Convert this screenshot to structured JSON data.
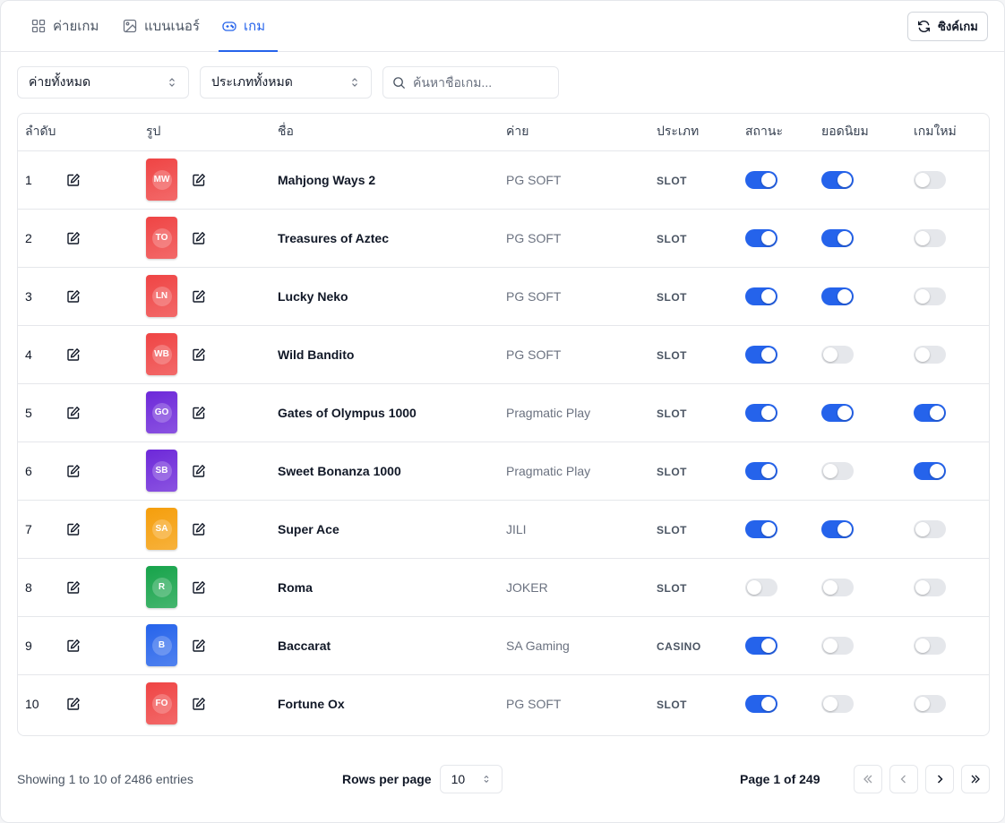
{
  "tabs": [
    {
      "label": "ค่ายเกม",
      "icon": "grid-icon",
      "active": false
    },
    {
      "label": "แบนเนอร์",
      "icon": "image-icon",
      "active": false
    },
    {
      "label": "เกม",
      "icon": "gamepad-icon",
      "active": true
    }
  ],
  "sync_button": {
    "label": "ซิงค์เกม",
    "icon": "refresh-icon"
  },
  "filters": {
    "provider_select": "ค่ายทั้งหมด",
    "type_select": "ประเภททั้งหมด",
    "search_placeholder": "ค้นหาชื่อเกม..."
  },
  "table": {
    "headers": [
      "ลำดับ",
      "รูป",
      "ชื่อ",
      "ค่าย",
      "ประเภท",
      "สถานะ",
      "ยอดนิยม",
      "เกมใหม่"
    ],
    "rows": [
      {
        "index": "1",
        "initials": "MW",
        "name": "Mahjong Ways 2",
        "provider": "PG SOFT",
        "type": "SLOT",
        "status": true,
        "popular": true,
        "new": false,
        "color": "#ef4444"
      },
      {
        "index": "2",
        "initials": "TO",
        "name": "Treasures of Aztec",
        "provider": "PG SOFT",
        "type": "SLOT",
        "status": true,
        "popular": true,
        "new": false,
        "color": "#ef4444"
      },
      {
        "index": "3",
        "initials": "LN",
        "name": "Lucky Neko",
        "provider": "PG SOFT",
        "type": "SLOT",
        "status": true,
        "popular": true,
        "new": false,
        "color": "#ef4444"
      },
      {
        "index": "4",
        "initials": "WB",
        "name": "Wild Bandito",
        "provider": "PG SOFT",
        "type": "SLOT",
        "status": true,
        "popular": false,
        "new": false,
        "color": "#ef4444"
      },
      {
        "index": "5",
        "initials": "GO",
        "name": "Gates of Olympus 1000",
        "provider": "Pragmatic Play",
        "type": "SLOT",
        "status": true,
        "popular": true,
        "new": true,
        "color": "#6d28d9"
      },
      {
        "index": "6",
        "initials": "SB",
        "name": "Sweet Bonanza 1000",
        "provider": "Pragmatic Play",
        "type": "SLOT",
        "status": true,
        "popular": false,
        "new": true,
        "color": "#6d28d9"
      },
      {
        "index": "7",
        "initials": "SA",
        "name": "Super Ace",
        "provider": "JILI",
        "type": "SLOT",
        "status": true,
        "popular": true,
        "new": false,
        "color": "#f59e0b"
      },
      {
        "index": "8",
        "initials": "R",
        "name": "Roma",
        "provider": "JOKER",
        "type": "SLOT",
        "status": false,
        "popular": false,
        "new": false,
        "color": "#16a34a"
      },
      {
        "index": "9",
        "initials": "B",
        "name": "Baccarat",
        "provider": "SA Gaming",
        "type": "CASINO",
        "status": true,
        "popular": false,
        "new": false,
        "color": "#2563eb"
      },
      {
        "index": "10",
        "initials": "FO",
        "name": "Fortune Ox",
        "provider": "PG SOFT",
        "type": "SLOT",
        "status": true,
        "popular": false,
        "new": false,
        "color": "#ef4444"
      }
    ]
  },
  "footer": {
    "entries_text": "Showing 1 to 10 of 2486 entries",
    "rows_per_page_label": "Rows per page",
    "rows_per_page_value": "10",
    "page_text": "Page 1 of 249"
  },
  "colors": {
    "accent": "#2563eb",
    "toggle_off": "#e5e7eb",
    "border": "#e5e7eb"
  }
}
